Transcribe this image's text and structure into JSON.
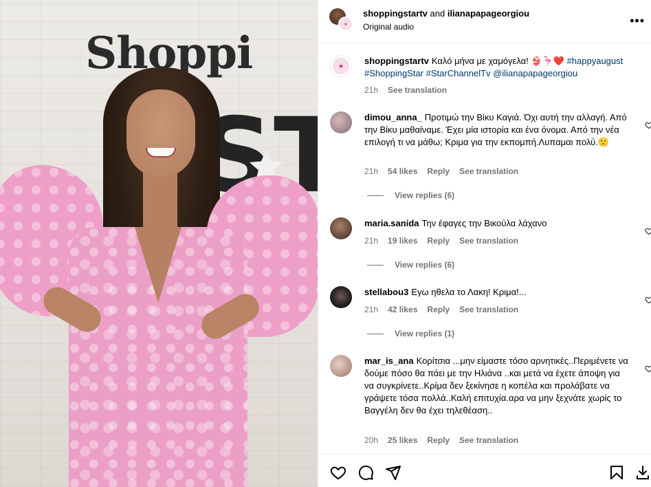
{
  "post": {
    "header_user1": "shoppingstartv",
    "header_and": " and ",
    "header_user2": "ilianapapageorgiou",
    "audio": "Original audio",
    "more_label": "•••",
    "photo_sign_top": "Shoppi",
    "photo_sign_bottom": "STA"
  },
  "caption": {
    "user": "shoppingstartv",
    "text_plain": "Καλό μήνα με χαμόγελα! 👙🦩❤️",
    "tags": "#happyaugust #ShoppingStar #StarChannelTv @ilianapapageorgiou",
    "time": "21h",
    "translate": "See translation"
  },
  "comments": [
    {
      "user": "dimou_anna_",
      "text": "Προτιμώ την Βίκυ Καγιά. Όχι αυτή την αλλαγή. Από την Βίκυ μαθαίναμε. Έχει μία ιστορία και ένα όνομα. Από την νέα επιλογή τι να μάθω; Κριμα για την εκπομπή.Λυπαμαι πολύ.🙁",
      "time": "21h",
      "likes": "54 likes",
      "reply": "Reply",
      "translate": "See translation",
      "view_replies": "View replies (6)"
    },
    {
      "user": "maria.sanida",
      "text": "Την έφαγες την Βικούλα λάχανο",
      "time": "21h",
      "likes": "19 likes",
      "reply": "Reply",
      "translate": "See translation",
      "view_replies": "View replies (6)"
    },
    {
      "user": "stellabou3",
      "text": "Εγω ηθελα το Λακη! Κριμα!...",
      "time": "21h",
      "likes": "42 likes",
      "reply": "Reply",
      "translate": "See translation",
      "view_replies": "View replies (1)"
    },
    {
      "user": "mar_is_ana",
      "text": "Κορίτσια ...μην είμαστε τόσο αρνητικές..Περιμένετε να δούμε πόσο θα πάει με την Ηλιάνα ..και μετά να έχετε άποψη για να συγκρίνετε..Κρίμα δεν ξεκίνησε η κοπέλα και προλάβατε να γράψετε τόσα πολλά..Καλή επιτυχία.αρα να μην ξεχνάτε χωρίς το Βαγγέλη δεν θα έχει τηλεθέαση..",
      "time": "20h",
      "likes": "25 likes",
      "reply": "Reply",
      "translate": "See translation"
    }
  ],
  "icons": {
    "like": "heart-icon",
    "comment": "comment-icon",
    "share": "share-icon",
    "save": "bookmark-icon",
    "download": "download-icon"
  }
}
